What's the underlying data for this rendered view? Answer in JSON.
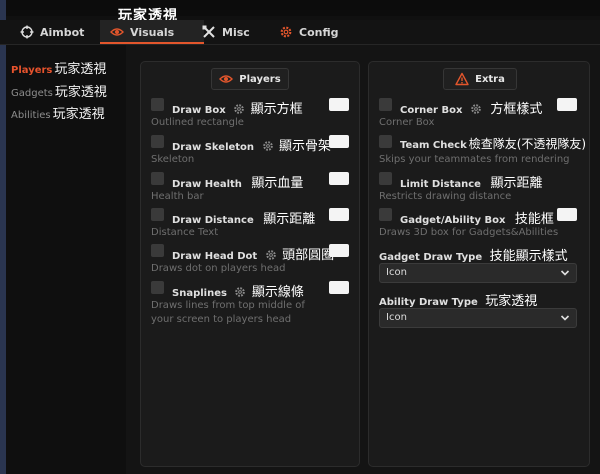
{
  "overlay_text": "玩家透視",
  "tabs": [
    {
      "label": "Aimbot",
      "icon": "crosshair-icon"
    },
    {
      "label": "Visuals",
      "icon": "eye-icon"
    },
    {
      "label": "Misc",
      "icon": "tools-icon"
    },
    {
      "label": "Config",
      "icon": "gear-icon"
    }
  ],
  "sidebar": {
    "items": [
      {
        "en": "Players",
        "cn": "玩家透視",
        "active": true
      },
      {
        "en": "Gadgets",
        "cn": "玩家透視",
        "active": false
      },
      {
        "en": "Abilities",
        "cn": "玩家透視",
        "active": false
      }
    ]
  },
  "players_panel": {
    "title": "Players",
    "options": [
      {
        "label": "Draw Box",
        "cn": "顯示方框",
        "desc": "Outlined rectangle"
      },
      {
        "label": "Draw Skeleton",
        "cn": "顯示骨架",
        "desc": "Skeleton"
      },
      {
        "label": "Draw Health",
        "cn": "顯示血量",
        "desc": "Health bar"
      },
      {
        "label": "Draw Distance",
        "cn": "顯示距離",
        "desc": "Distance Text"
      },
      {
        "label": "Draw Head Dot",
        "cn": "頭部圓圈",
        "desc": "Draws dot on players head"
      },
      {
        "label": "Snaplines",
        "cn": "顯示線條",
        "desc": "Draws lines from top middle of",
        "desc2": "your screen to players head"
      }
    ]
  },
  "extra_panel": {
    "title": "Extra",
    "options": [
      {
        "label": "Corner Box",
        "cn": "方框樣式",
        "desc": "Corner Box"
      },
      {
        "label": "Team Check",
        "cn": "檢查隊友(不透視隊友)",
        "desc": "Skips your teammates from rendering"
      },
      {
        "label": "Limit Distance",
        "cn": "顯示距離",
        "desc": "Restricts drawing distance"
      },
      {
        "label": "Gadget/Ability Box",
        "cn": "技能框",
        "desc": "Draws 3D box for Gadgets&Abilities"
      }
    ],
    "gadget_draw_type": {
      "label": "Gadget Draw Type",
      "cn": "技能顯示樣式",
      "value": "Icon"
    },
    "ability_draw_type": {
      "label": "Ability Draw Type",
      "cn": "玩家透視",
      "value": "Icon"
    }
  },
  "colors": {
    "accent": "#e3562c",
    "background": "#101010",
    "panel": "#1b1b1b",
    "checkbox": "#3a3a3a",
    "toggle": "#f4f4f4"
  }
}
